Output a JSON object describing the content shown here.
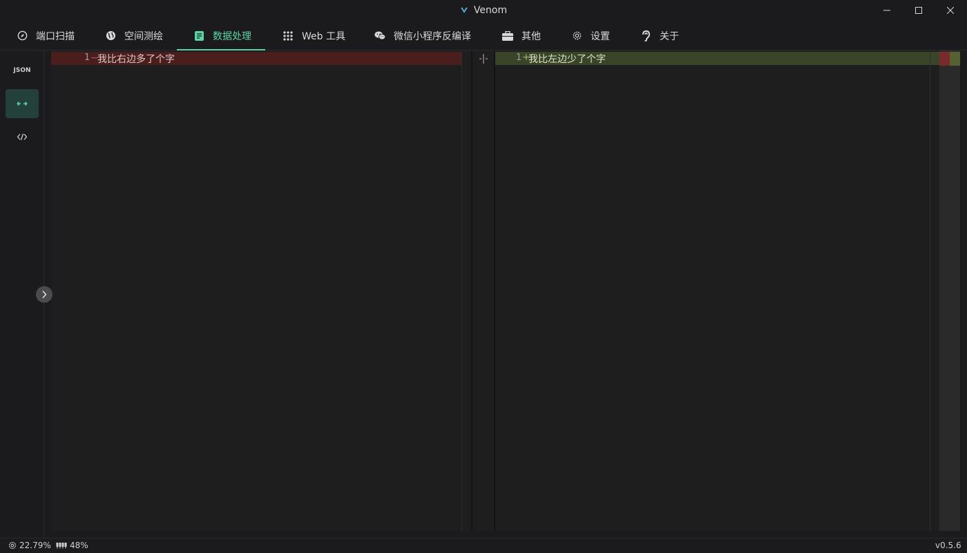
{
  "window": {
    "title": "Venom"
  },
  "nav": {
    "tabs": [
      {
        "label": "端口扫描",
        "icon": "compass-icon"
      },
      {
        "label": "空间测绘",
        "icon": "globe-icon"
      },
      {
        "label": "数据处理",
        "icon": "document-icon",
        "active": true
      },
      {
        "label": "Web 工具",
        "icon": "grid-dots-icon"
      },
      {
        "label": "微信小程序反编译",
        "icon": "wechat-icon"
      },
      {
        "label": "其他",
        "icon": "briefcase-icon"
      },
      {
        "label": "设置",
        "icon": "gear-icon"
      },
      {
        "label": "关于",
        "icon": "ear-icon"
      }
    ]
  },
  "sidebar": {
    "items": [
      {
        "label": "JSON",
        "icon": "json-icon"
      },
      {
        "label": "",
        "icon": "diff-arrows-icon",
        "active": true
      },
      {
        "label": "",
        "icon": "code-icon"
      }
    ]
  },
  "diff": {
    "left": {
      "line_number": "1",
      "marker": "−",
      "text": "我比右边多了个字"
    },
    "right": {
      "line_number": "1",
      "marker": "+",
      "text": "我比左边少了个字"
    }
  },
  "status": {
    "cpu": "22.79%",
    "memory": "48%",
    "version": "v0.5.6"
  },
  "colors": {
    "accent": "#5bd5a4",
    "deleted_line": "#4b1e1e",
    "inserted_line": "#3a4428"
  }
}
